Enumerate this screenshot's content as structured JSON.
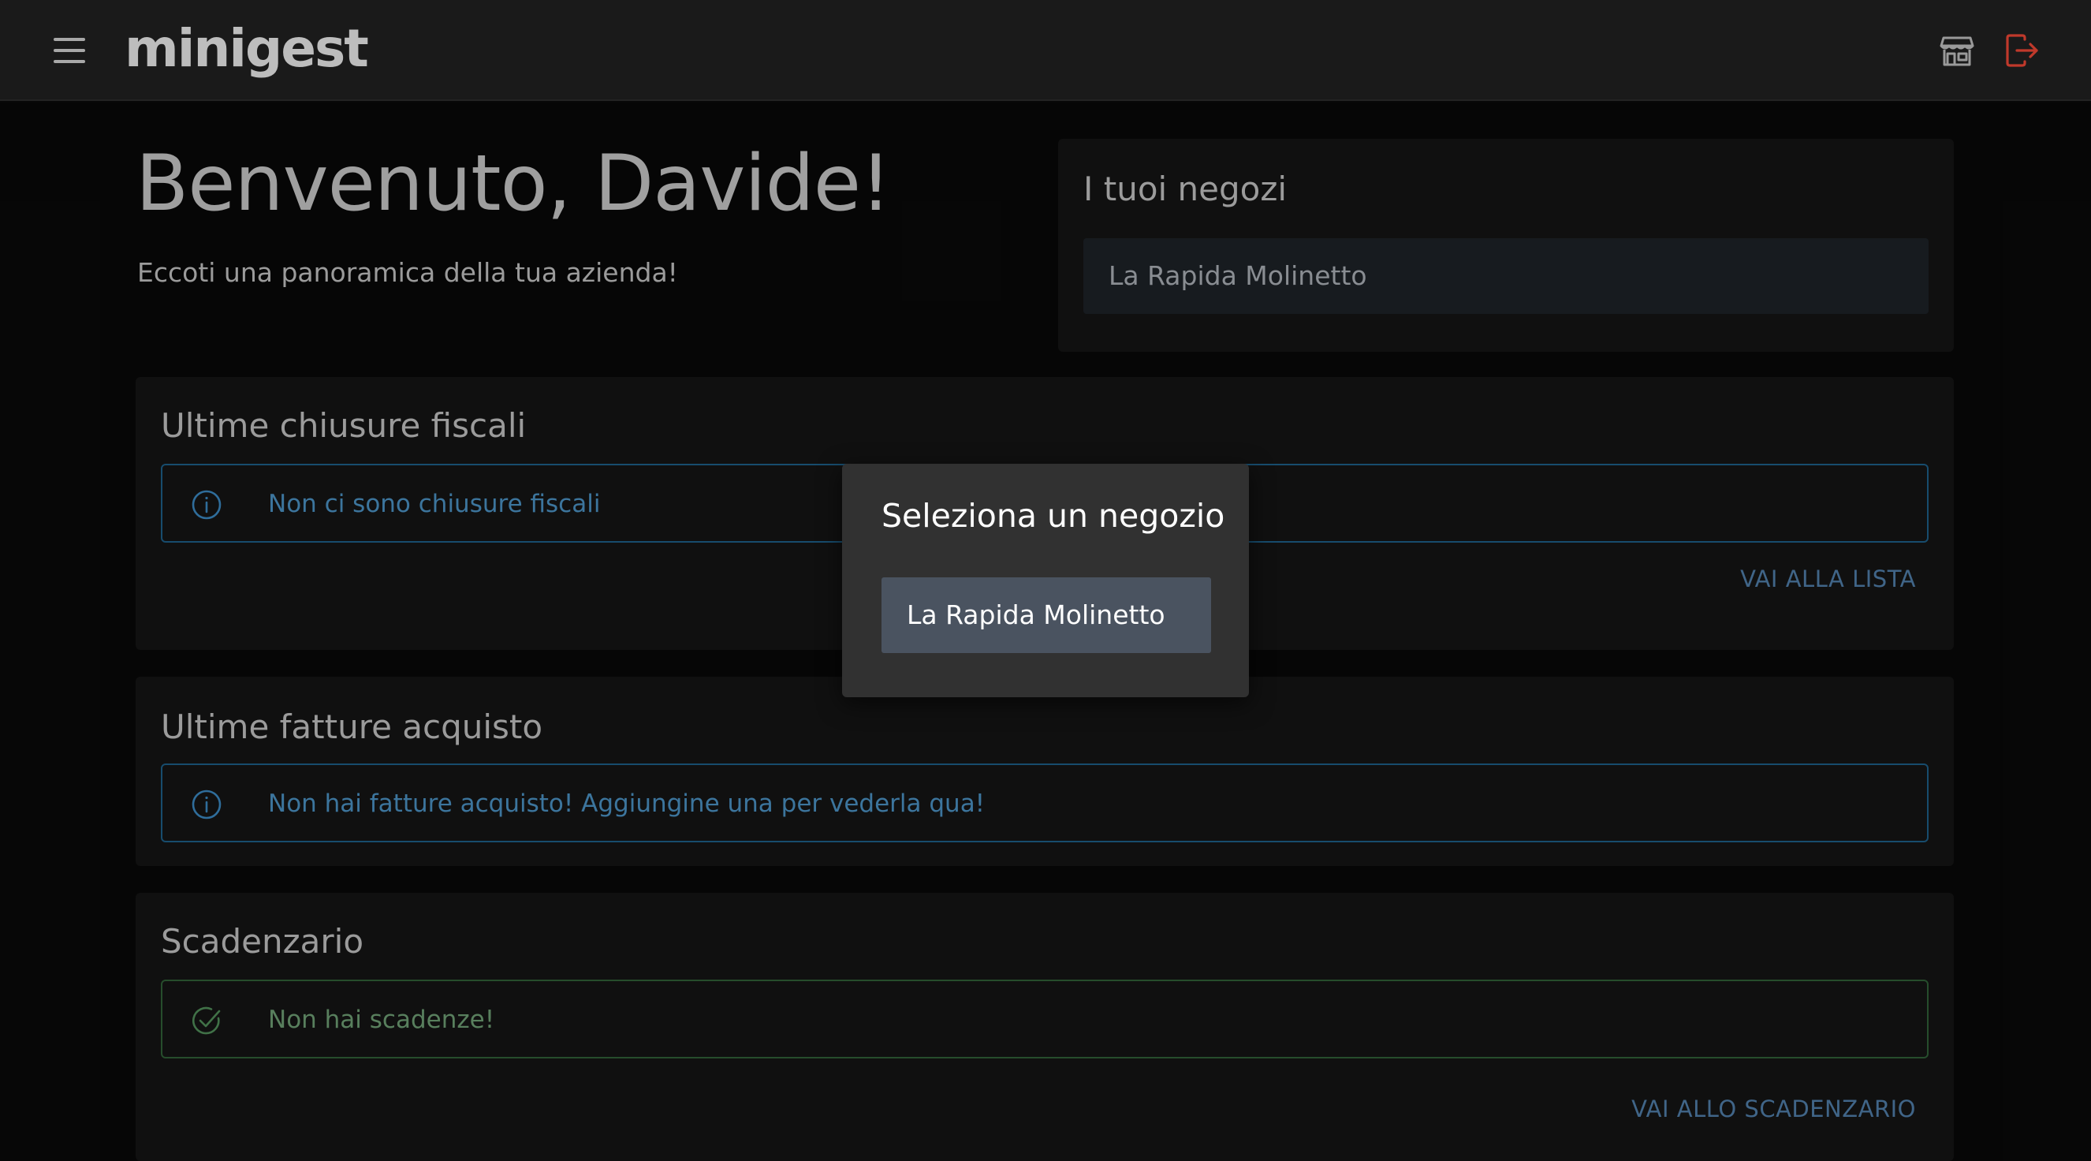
{
  "app": {
    "logo": "minigest"
  },
  "header": {
    "menu_icon": "hamburger-menu-icon",
    "store_icon": "store-icon",
    "logout_icon": "logout-icon",
    "logout_color": "#c0392b"
  },
  "welcome": {
    "title": "Benvenuto, Davide!",
    "subtitle": "Eccoti una panoramica della tua azienda!"
  },
  "stores": {
    "title": "I tuoi negozi",
    "items": [
      {
        "label": "La Rapida Molinetto"
      }
    ]
  },
  "fiscal_closures": {
    "title": "Ultime chiusure fiscali",
    "alert": "Non ci sono chiusure fiscali",
    "alert_icon": "info-circle-icon",
    "link": "VAI ALLA LISTA"
  },
  "purchase_invoices": {
    "title": "Ultime fatture acquisto",
    "alert": "Non hai fatture acquisto! Aggiungine una per vederla qua!",
    "alert_icon": "info-circle-icon"
  },
  "deadlines": {
    "title": "Scadenzario",
    "alert": "Non hai scadenze!",
    "alert_icon": "check-circle-icon",
    "link": "VAI ALLO SCADENZARIO"
  },
  "modal": {
    "title": "Seleziona un negozio",
    "options": [
      {
        "label": "La Rapida Molinetto"
      }
    ]
  },
  "colors": {
    "background": "#080808",
    "header": "#1a1a1a",
    "card": "#141414",
    "info": "#4a8fc0",
    "success": "#6c9b72",
    "link": "#4f7ca6",
    "modal": "#313131",
    "modal_option": "#4a5360"
  }
}
